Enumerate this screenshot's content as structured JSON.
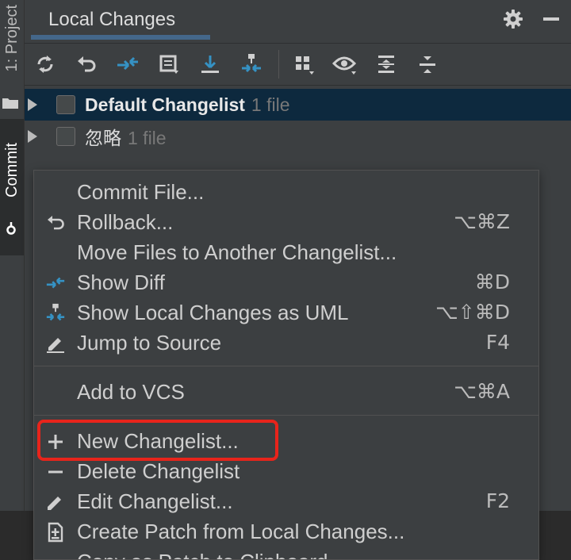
{
  "stripe": {
    "project_label": "1: Project",
    "commit_label": "Commit"
  },
  "titlebar": {
    "tab_label": "Local Changes",
    "icons": [
      "gear-icon",
      "minimize-icon"
    ]
  },
  "toolbar": {
    "icons": [
      "refresh-icon",
      "rollback-icon",
      "diff-icon",
      "commit-message-icon",
      "update-icon",
      "uml-icon",
      "group-by-icon",
      "show-icon",
      "expand-all-icon",
      "collapse-all-icon"
    ]
  },
  "tree": {
    "rows": [
      {
        "label": "Default Changelist",
        "count": "1 file",
        "selected": true
      },
      {
        "label": "忽略",
        "count": "1 file",
        "selected": false
      }
    ]
  },
  "menu": {
    "items": [
      {
        "label": "Commit File...",
        "shortcut": "",
        "icon": ""
      },
      {
        "label": "Rollback...",
        "shortcut": "⌥⌘Z",
        "icon": "rollback-icon"
      },
      {
        "label": "Move Files to Another Changelist...",
        "shortcut": "",
        "icon": ""
      },
      {
        "label": "Show Diff",
        "shortcut": "⌘D",
        "icon": "diff-icon"
      },
      {
        "label": "Show Local Changes as UML",
        "shortcut": "⌥⇧⌘D",
        "icon": "uml-icon"
      },
      {
        "label": "Jump to Source",
        "shortcut": "F4",
        "icon": "pencil-icon"
      },
      {
        "label": "Add to VCS",
        "shortcut": "⌥⌘A",
        "icon": ""
      },
      {
        "label": "New Changelist...",
        "shortcut": "",
        "icon": "plus-icon"
      },
      {
        "label": "Delete Changelist",
        "shortcut": "",
        "icon": "minus-icon"
      },
      {
        "label": "Edit Changelist...",
        "shortcut": "F2",
        "icon": "pencil-icon"
      },
      {
        "label": "Create Patch from Local Changes...",
        "shortcut": "",
        "icon": "patch-icon"
      },
      {
        "label": "Copy as Patch to Clipboard",
        "shortcut": "",
        "icon": ""
      }
    ]
  },
  "colors": {
    "background": "#3c3f41",
    "selection": "#0d293e",
    "accent_blue": "#3592c4",
    "highlight_red": "#e8241b"
  }
}
